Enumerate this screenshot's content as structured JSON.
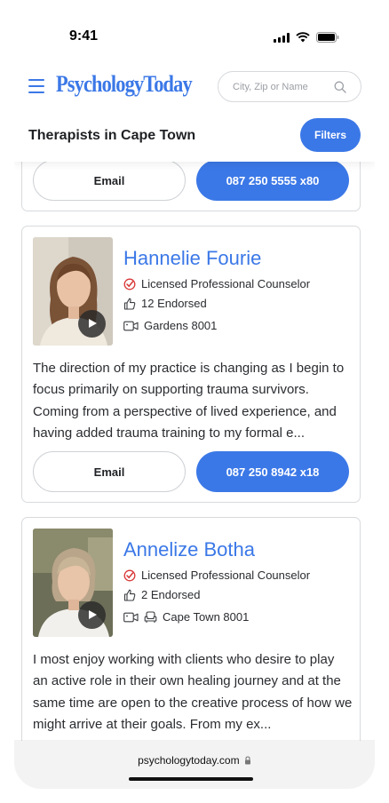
{
  "status_bar": {
    "time": "9:41"
  },
  "header": {
    "logo": "PsychologyToday",
    "search_placeholder": "City, Zip or Name",
    "page_title": "Therapists in Cape Town",
    "filters_label": "Filters"
  },
  "colors": {
    "accent": "#3b78e7",
    "border": "#d8dadd",
    "text": "#1f2124"
  },
  "listings": [
    {
      "email_label": "Email",
      "phone_label": "087 250 5555 x80"
    },
    {
      "name": "Hannelie Fourie",
      "credential": "Licensed Professional Counselor",
      "endorsed": "12 Endorsed",
      "location": "Gardens 8001",
      "bio": "The direction of my practice is changing as I begin to focus primarily on supporting trauma survivors. Coming from a perspective of lived experience, and having added trauma training to my formal e...",
      "email_label": "Email",
      "phone_label": "087 250 8942 x18"
    },
    {
      "name": "Annelize Botha",
      "credential": "Licensed Professional Counselor",
      "endorsed": "2 Endorsed",
      "location": "Cape Town 8001",
      "bio": "I most enjoy working with clients who desire to play an active role in their own healing journey and at the same time are open to the creative process of how we might arrive at their goals. From my ex..."
    }
  ],
  "browser": {
    "url": "psychologytoday.com"
  }
}
